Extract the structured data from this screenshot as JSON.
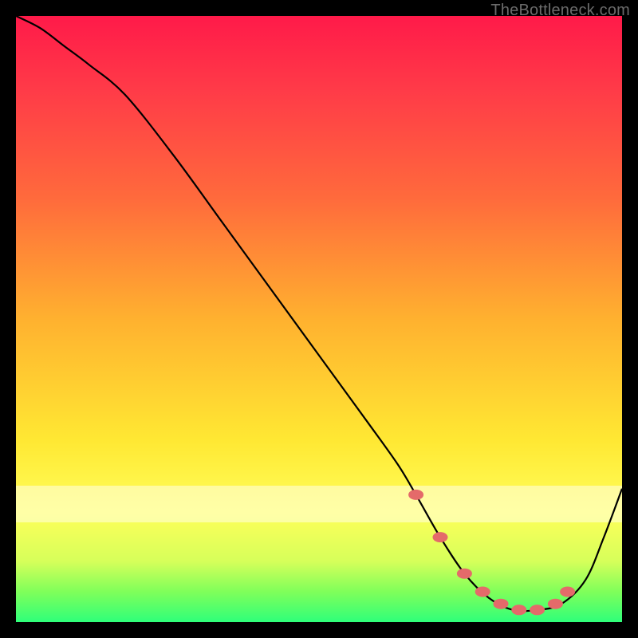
{
  "watermark": "TheBottleneck.com",
  "colors": {
    "frame": "#000000",
    "gradient_top": "#ff1a49",
    "gradient_mid": "#ffe833",
    "gradient_bottom": "#2fff7a",
    "curve": "#000000",
    "marker": "#e46a6a"
  },
  "chart_data": {
    "type": "line",
    "title": "",
    "xlabel": "",
    "ylabel": "",
    "xlim": [
      0,
      100
    ],
    "ylim": [
      0,
      100
    ],
    "series": [
      {
        "name": "bottleneck-curve",
        "x": [
          0,
          4,
          8,
          12,
          18,
          26,
          34,
          42,
          50,
          58,
          63,
          66,
          70,
          74,
          78,
          82,
          86,
          90,
          94,
          97,
          100
        ],
        "y": [
          100,
          98,
          95,
          92,
          87,
          77,
          66,
          55,
          44,
          33,
          26,
          21,
          14,
          8,
          4,
          2,
          2,
          3,
          7,
          14,
          22
        ]
      }
    ],
    "markers": {
      "name": "highlight-points",
      "x": [
        66,
        70,
        74,
        77,
        80,
        83,
        86,
        89,
        91
      ],
      "y": [
        21,
        14,
        8,
        5,
        3,
        2,
        2,
        3,
        5
      ]
    },
    "whiteband": {
      "y_from": 18,
      "y_to": 23
    }
  }
}
